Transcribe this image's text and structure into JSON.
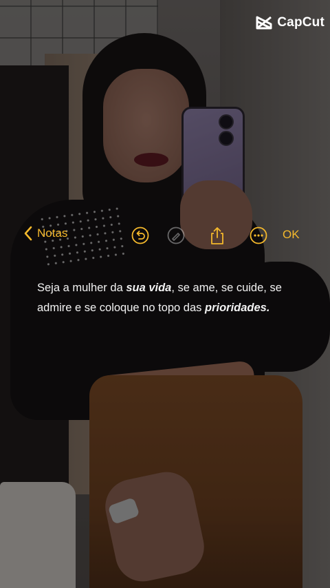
{
  "watermark": {
    "brand": "CapCut",
    "icon": "capcut-logo-icon"
  },
  "toolbar": {
    "back_label": "Notas",
    "back_icon": "chevron-left-icon",
    "undo_icon": "undo-icon",
    "markup_icon": "markup-icon",
    "share_icon": "share-icon",
    "more_icon": "more-icon",
    "done_label": "OK",
    "accent_color": "#f5b92c"
  },
  "note": {
    "t1": "Seja a mulher da ",
    "b1": "sua vida",
    "t2": ", se ame, se cuide, se admire e se coloque no topo das ",
    "b2": "prioridades."
  }
}
